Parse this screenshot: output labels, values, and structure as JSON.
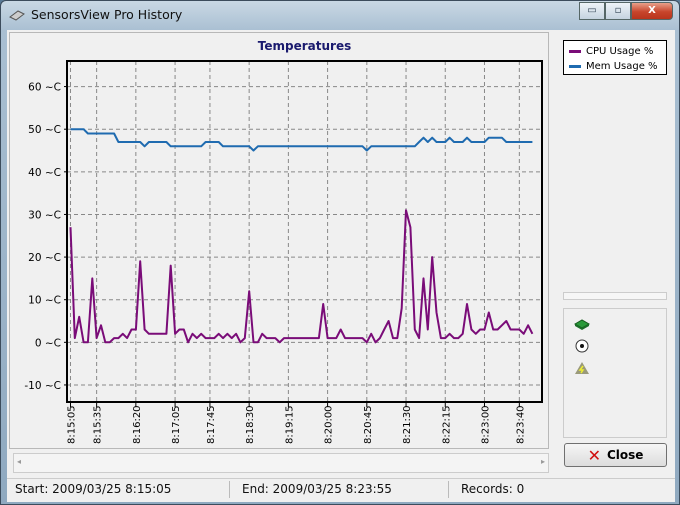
{
  "window": {
    "title": "SensorsView Pro History",
    "minimize": "▭",
    "maximize": "▫",
    "close": "X"
  },
  "chart_data": {
    "type": "line",
    "title": "Temperatures",
    "ylim": [
      -14,
      66
    ],
    "yticks": [
      60,
      50,
      40,
      30,
      20,
      10,
      0,
      -10
    ],
    "ytick_suffix": " ~C",
    "x_start_seconds": 0,
    "x_step_seconds": 5,
    "xlim_seconds": [
      -4,
      541
    ],
    "xticks": [
      {
        "t": 0,
        "label": "8:15:05"
      },
      {
        "t": 30,
        "label": "8:15:35"
      },
      {
        "t": 75,
        "label": "8:16:20"
      },
      {
        "t": 120,
        "label": "8:17:05"
      },
      {
        "t": 160,
        "label": "8:17:45"
      },
      {
        "t": 205,
        "label": "8:18:30"
      },
      {
        "t": 250,
        "label": "8:19:15"
      },
      {
        "t": 295,
        "label": "8:20:00"
      },
      {
        "t": 340,
        "label": "8:20:45"
      },
      {
        "t": 385,
        "label": "8:21:30"
      },
      {
        "t": 430,
        "label": "8:22:15"
      },
      {
        "t": 475,
        "label": "8:23:00"
      },
      {
        "t": 515,
        "label": "8:23:40"
      }
    ],
    "grid": true,
    "legend_placement": "right",
    "series": [
      {
        "name": "CPU Usage %",
        "color": "#7a0c78",
        "values": [
          27,
          1,
          6,
          0,
          0,
          15,
          1,
          4,
          0,
          0,
          1,
          1,
          2,
          1,
          3,
          3,
          19,
          3,
          2,
          2,
          2,
          2,
          2,
          18,
          2,
          3,
          3,
          0,
          2,
          1,
          2,
          1,
          1,
          1,
          2,
          1,
          2,
          1,
          2,
          0,
          1,
          12,
          0,
          0,
          2,
          1,
          1,
          1,
          0,
          1,
          1,
          1,
          1,
          1,
          1,
          1,
          1,
          1,
          9,
          1,
          1,
          1,
          3,
          1,
          1,
          1,
          1,
          1,
          0,
          2,
          0,
          1,
          3,
          5,
          1,
          1,
          8,
          31,
          27,
          3,
          1,
          15,
          3,
          20,
          7,
          1,
          1,
          2,
          1,
          1,
          2,
          9,
          3,
          2,
          3,
          3,
          7,
          3,
          3,
          4,
          5,
          3,
          3,
          3,
          2,
          4,
          2
        ]
      },
      {
        "name": "Mem Usage %",
        "color": "#1f6bb0",
        "values": [
          50,
          50,
          50,
          50,
          49,
          49,
          49,
          49,
          49,
          49,
          49,
          47,
          47,
          47,
          47,
          47,
          47,
          46,
          47,
          47,
          47,
          47,
          47,
          46,
          46,
          46,
          46,
          46,
          46,
          46,
          46,
          47,
          47,
          47,
          47,
          46,
          46,
          46,
          46,
          46,
          46,
          46,
          45,
          46,
          46,
          46,
          46,
          46,
          46,
          46,
          46,
          46,
          46,
          46,
          46,
          46,
          46,
          46,
          46,
          46,
          46,
          46,
          46,
          46,
          46,
          46,
          46,
          46,
          45,
          46,
          46,
          46,
          46,
          46,
          46,
          46,
          46,
          46,
          46,
          46,
          47,
          48,
          47,
          48,
          47,
          47,
          47,
          48,
          47,
          47,
          47,
          48,
          47,
          47,
          47,
          47,
          48,
          48,
          48,
          48,
          47,
          47,
          47,
          47,
          47,
          47,
          47
        ]
      }
    ]
  },
  "status": {
    "start": "Start: 2009/03/25 8:15:05",
    "end": "End: 2009/03/25 8:23:55",
    "records": "Records: 0"
  },
  "buttons": {
    "close": "Close"
  },
  "scroll": {
    "left": "◂",
    "right": "▸"
  }
}
